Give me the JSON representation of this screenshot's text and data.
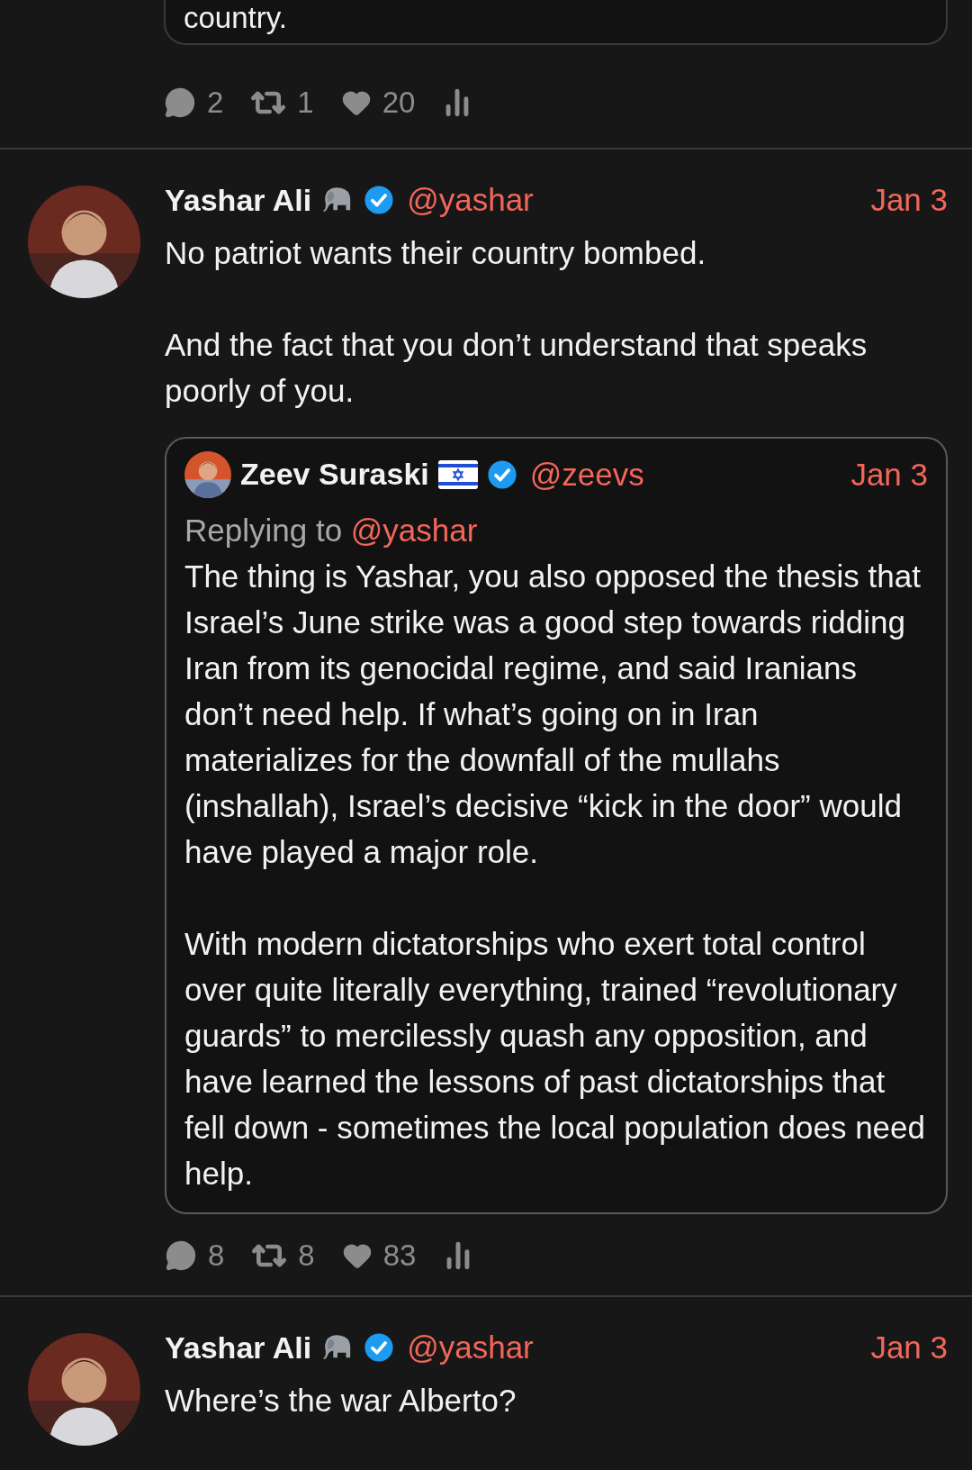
{
  "top_tweet": {
    "quote_text": "country.",
    "stats": {
      "replies": "2",
      "retweets": "1",
      "likes": "20"
    }
  },
  "tweets": [
    {
      "name": "Yashar Ali",
      "emoji": {
        "kind": "elephant"
      },
      "verified": true,
      "handle": "@yashar",
      "date": "Jan 3",
      "text": "No patriot wants their country bombed.\n\nAnd the fact that you don’t understand that speaks poorly of you.",
      "quote": {
        "name": "Zeev Suraski",
        "emoji": {
          "kind": "israel_flag"
        },
        "verified": true,
        "handle": "@zeevs",
        "date": "Jan 3",
        "reply_prefix": "Replying to",
        "reply_handle": "@yashar",
        "text": "The thing is Yashar, you also opposed the thesis that Israel’s June strike was a good step towards ridding Iran from its genocidal regime, and said Iranians don’t need help.  If what’s going on in Iran materializes for the downfall of the mullahs (inshallah), Israel’s decisive “kick in the door” would have played a major role.\n\nWith modern dictatorships who exert total control over quite literally everything, trained “revolutionary guards” to mercilessly quash any opposition, and have learned the lessons of past dictatorships that fell down - sometimes the local population does need help."
      },
      "stats": {
        "replies": "8",
        "retweets": "8",
        "likes": "83"
      }
    },
    {
      "name": "Yashar Ali",
      "emoji": {
        "kind": "elephant"
      },
      "verified": true,
      "handle": "@yashar",
      "date": "Jan 3",
      "text": "Where’s the war Alberto?"
    }
  ]
}
